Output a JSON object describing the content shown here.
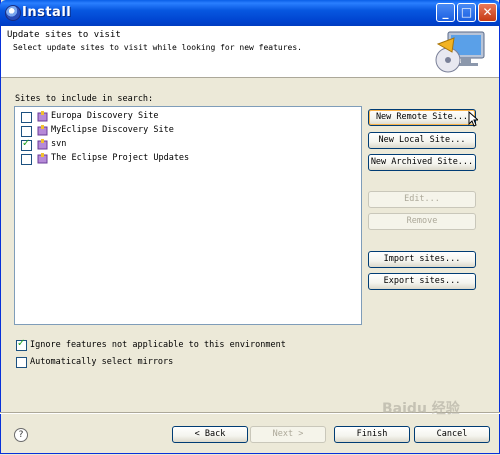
{
  "window": {
    "title": "Install"
  },
  "header": {
    "title": "Update sites to visit",
    "subtitle": "Select update sites to visit while looking for new features."
  },
  "sites": {
    "label": "Sites to include in search:",
    "items": [
      {
        "label": "Europa Discovery Site",
        "checked": false
      },
      {
        "label": "MyEclipse Discovery Site",
        "checked": false
      },
      {
        "label": "svn",
        "checked": true
      },
      {
        "label": "The Eclipse Project Updates",
        "checked": false
      }
    ]
  },
  "side_buttons": {
    "new_remote": "New Remote Site...",
    "new_local": "New Local Site...",
    "new_archived": "New Archived Site...",
    "edit": "Edit...",
    "remove": "Remove",
    "import": "Import sites...",
    "export": "Export sites..."
  },
  "options": {
    "ignore_features": {
      "label": "Ignore features not applicable to this environment",
      "checked": true
    },
    "auto_mirrors": {
      "label": "Automatically select mirrors",
      "checked": false
    }
  },
  "footer": {
    "back": "< Back",
    "next": "Next >",
    "finish": "Finish",
    "cancel": "Cancel",
    "help_icon": "?"
  },
  "watermark": "Baidu 经验",
  "colors": {
    "title_bar": "#0054e3",
    "dialog_bg": "#ece9d8",
    "close_button": "#c63a14"
  }
}
